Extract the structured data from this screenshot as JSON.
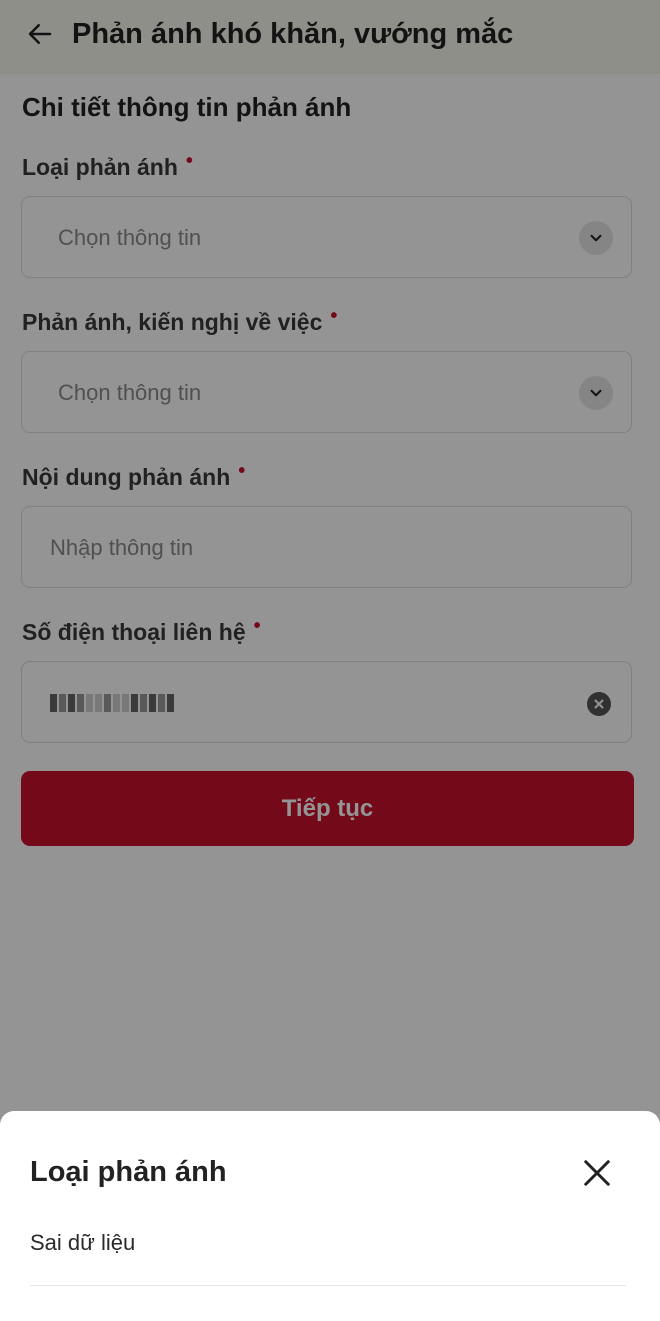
{
  "header": {
    "title": "Phản ánh khó khăn, vướng mắc",
    "back_icon": "arrow-left-icon"
  },
  "form": {
    "section_title": "Chi tiết thông tin phản ánh",
    "required_mark": "•",
    "fields": [
      {
        "label": "Loại phản ánh",
        "placeholder": "Chọn thông tin",
        "type": "select"
      },
      {
        "label": "Phản ánh, kiến nghị về việc",
        "placeholder": "Chọn thông tin",
        "type": "select"
      },
      {
        "label": "Nội dung phản ánh",
        "placeholder": "Nhập thông tin",
        "type": "text"
      },
      {
        "label": "Số điện thoại liên hệ",
        "type": "tel"
      }
    ],
    "submit_label": "Tiếp tục"
  },
  "colors": {
    "accent": "#c8102e",
    "header_bg": "#f6f7ee"
  },
  "sheet": {
    "title": "Loại phản ánh",
    "close_icon": "close-icon",
    "options": [
      "Sai dữ liệu"
    ]
  }
}
